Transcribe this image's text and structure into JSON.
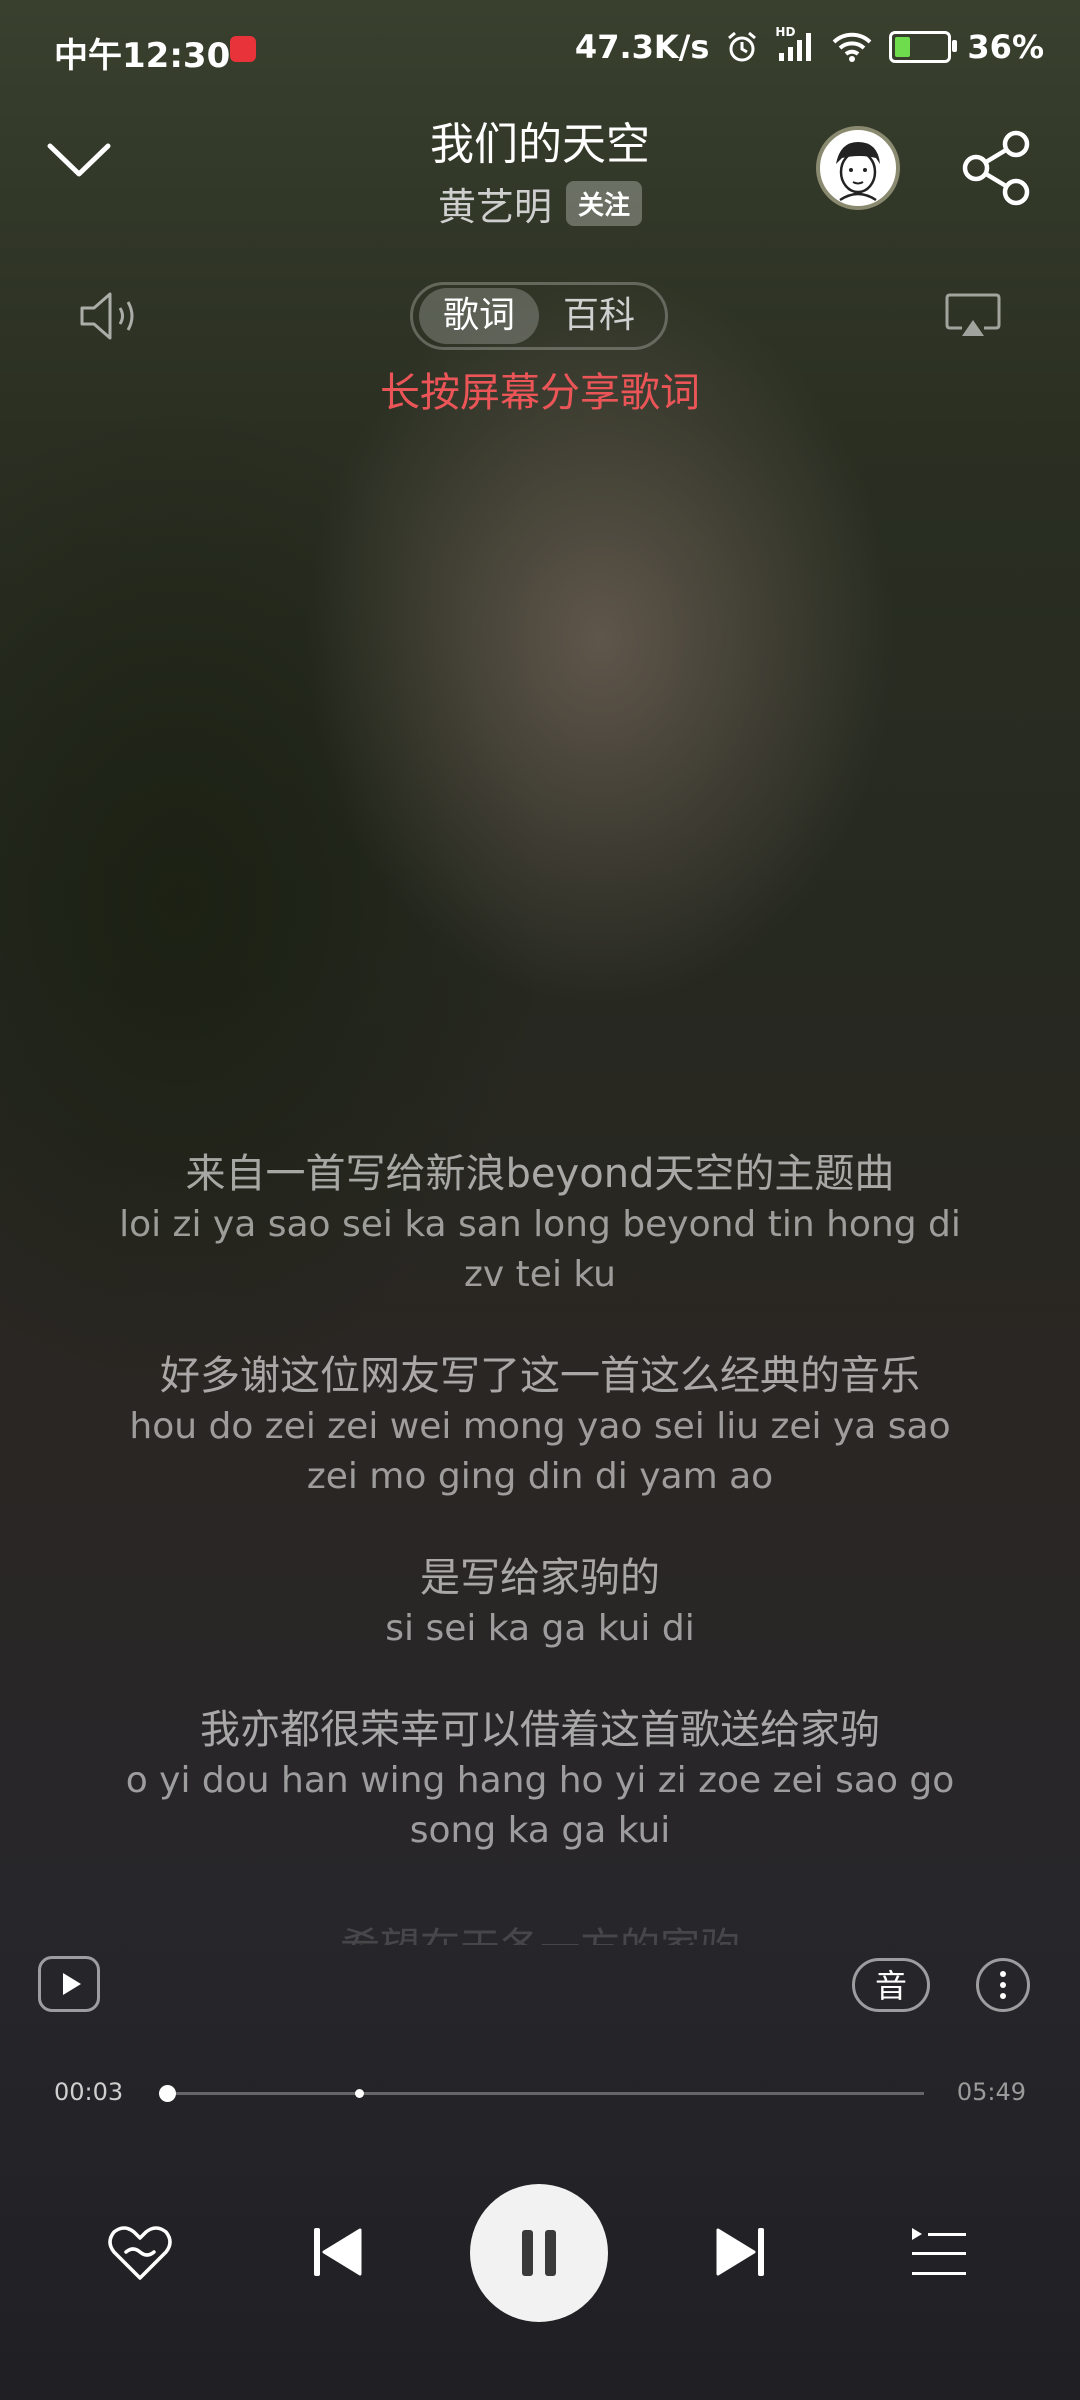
{
  "status_bar": {
    "time": "中午12:30",
    "network_speed": "47.3K/s",
    "hd_label": "HD",
    "battery": "36%",
    "battery_level": 0.36
  },
  "header": {
    "title": "我们的天空",
    "artist": "黄艺明",
    "follow_label": "关注"
  },
  "tabs": [
    {
      "label": "歌词",
      "active": true
    },
    {
      "label": "百科",
      "active": false
    }
  ],
  "hint": "长按屏幕分享歌词",
  "lyrics": [
    {
      "zh": "来自一首写给新浪beyond天空的主题曲",
      "py": "loi zi ya sao sei ka san long beyond tin hong di zv tei ku"
    },
    {
      "zh": "好多谢这位网友写了这一首这么经典的音乐",
      "py": "hou do zei zei wei mong yao sei liu zei ya sao zei mo ging din di yam ao"
    },
    {
      "zh": "是写给家驹的",
      "py": "si sei ka ga kui di"
    },
    {
      "zh": "我亦都很荣幸可以借着这首歌送给家驹",
      "py": "o yi dou han wing hang ho yi zi zoe zei sao go song ka ga kui"
    }
  ],
  "lyrics_faded_next": "希望在天各一方的家驹",
  "controls": {
    "sound_effect_label": "音"
  },
  "progress": {
    "current": "00:03",
    "total": "05:49",
    "played_fraction": 0.009,
    "buffered_fraction": 0.26
  },
  "colors": {
    "hint": "#ec5558",
    "battery_charge": "#6fdc4e"
  },
  "icons": [
    "chevron-down-icon",
    "share-icon",
    "volume-icon",
    "cast-icon",
    "mv-play-icon",
    "more-icon",
    "heart-icon",
    "previous-icon",
    "pause-icon",
    "next-icon",
    "playlist-icon"
  ]
}
